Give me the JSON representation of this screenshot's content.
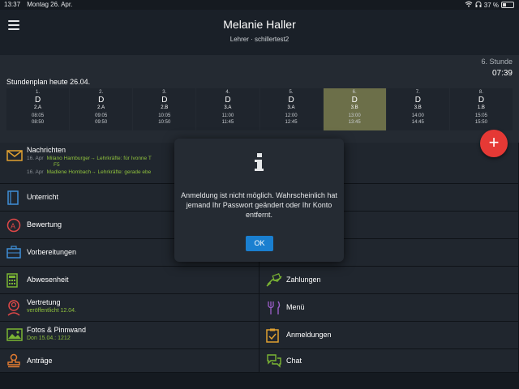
{
  "status_bar": {
    "time": "13:37",
    "date": "Montag 26. Apr.",
    "battery": "37 %"
  },
  "header": {
    "title": "Melanie Haller",
    "subtitle": "Lehrer · schillertest2"
  },
  "schedule": {
    "current_lesson": "6. Stunde",
    "current_time": "07:39",
    "title": "Stundenplan heute 26.04.",
    "periods": [
      {
        "no": "1.",
        "subject": "D",
        "room": "2.A",
        "start": "08:05",
        "end": "08:50",
        "active": false
      },
      {
        "no": "2.",
        "subject": "D",
        "room": "2.A",
        "start": "09:05",
        "end": "09:50",
        "active": false
      },
      {
        "no": "3.",
        "subject": "D",
        "room": "2.B",
        "start": "10:05",
        "end": "10:50",
        "active": false
      },
      {
        "no": "4.",
        "subject": "D",
        "room": "3.A",
        "start": "11:00",
        "end": "11:45",
        "active": false
      },
      {
        "no": "5.",
        "subject": "D",
        "room": "3.A",
        "start": "12:00",
        "end": "12:45",
        "active": false
      },
      {
        "no": "6.",
        "subject": "D",
        "room": "3.B",
        "start": "13:00",
        "end": "13:45",
        "active": true
      },
      {
        "no": "7.",
        "subject": "D",
        "room": "3.B",
        "start": "14:00",
        "end": "14:45",
        "active": false
      },
      {
        "no": "8.",
        "subject": "D",
        "room": "1.B",
        "start": "15:05",
        "end": "15:50",
        "active": false
      }
    ]
  },
  "fab": {
    "label": "+"
  },
  "tiles": {
    "nachrichten": {
      "label": "Nachrichten",
      "messages": [
        {
          "date": "16. Apr",
          "text": "Milano Hamburger→ Lehrkräfte: für Ivonne T"
        },
        {
          "date": "",
          "text": "F5"
        },
        {
          "date": "16. Apr",
          "text": "Madlene Hombach→ Lehrkräfte: gerade ebe"
        }
      ]
    },
    "unterricht": {
      "label": "Unterricht"
    },
    "bewertung": {
      "label": "Bewertung"
    },
    "vorbereitungen": {
      "label": "Vorbereitungen"
    },
    "abwesenheit": {
      "label": "Abwesenheit"
    },
    "zahlungen": {
      "label": "Zahlungen"
    },
    "vertretung": {
      "label": "Vertretung",
      "sub": "veröffentlicht 12.04."
    },
    "menu": {
      "label": "Menü"
    },
    "fotos": {
      "label": "Fotos & Pinnwand",
      "sub": "Don 15.04.: 1212"
    },
    "anmeldungen": {
      "label": "Anmeldungen"
    },
    "antraege": {
      "label": "Anträge"
    },
    "chat": {
      "label": "Chat"
    }
  },
  "dialog": {
    "icon": "info-icon",
    "message": "Anmeldung ist nicht möglich. Wahrscheinlich hat jemand Ihr Passwort geändert oder Ihr Konto entfernt.",
    "ok_label": "OK"
  },
  "colors": {
    "accent_green": "#8fc13d",
    "active_period": "#6c6f49",
    "fab": "#e53935",
    "ok_button": "#1a7fd0"
  }
}
